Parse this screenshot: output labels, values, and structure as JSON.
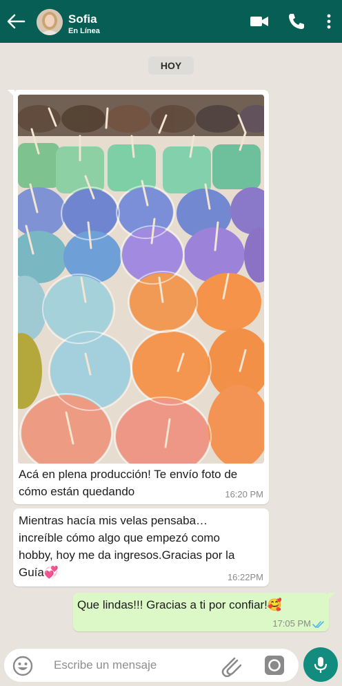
{
  "header": {
    "contact_name": "Sofia",
    "contact_status": "En Línea",
    "accent_color": "#075e54",
    "icons": [
      "back-arrow-icon",
      "video-call-icon",
      "phone-call-icon",
      "more-options-icon"
    ]
  },
  "chat": {
    "day_label": "HOY",
    "messages": [
      {
        "direction": "incoming",
        "has_image": true,
        "image_description_icon": "candles-photo",
        "text_lines": [
          "Acá en plena producción! Te envío foto de",
          "cómo están quedando"
        ],
        "time": "16:20 PM"
      },
      {
        "direction": "incoming",
        "has_image": false,
        "text_lines": [
          "Mientras hacía mis velas pensaba…",
          "increíble cómo algo que empezó como",
          "hobby, hoy me da ingresos.Gracias por la",
          "Guía💞"
        ],
        "time": "16:22PM"
      },
      {
        "direction": "outgoing",
        "has_image": false,
        "text_lines": [
          "Que lindas!!! Gracias a ti por confiar!🥰"
        ],
        "time": "17:05 PM",
        "read_status": "double-check-read-icon"
      }
    ]
  },
  "composer": {
    "placeholder": "Escribe un mensaje",
    "icons": [
      "emoji-icon",
      "attach-icon",
      "camera-icon",
      "mic-icon"
    ]
  }
}
